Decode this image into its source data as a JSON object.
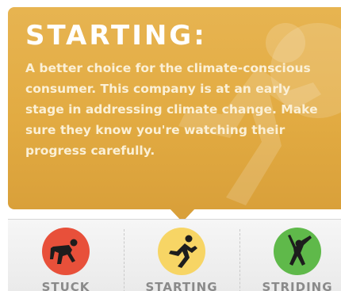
{
  "tooltip": {
    "title": "STARTING:",
    "body": "A better choice for the climate-conscious consumer. This company is at an early stage in addressing climate change. Make sure they know you're watching their progress carefully.",
    "color": "#e2ab42"
  },
  "stages": [
    {
      "label": "STUCK",
      "color": "#e8503a",
      "icon": "stuck-runner-icon"
    },
    {
      "label": "STARTING",
      "color": "#f7d565",
      "icon": "starting-runner-icon"
    },
    {
      "label": "STRIDING",
      "color": "#5fb94a",
      "icon": "striding-runner-icon"
    }
  ]
}
